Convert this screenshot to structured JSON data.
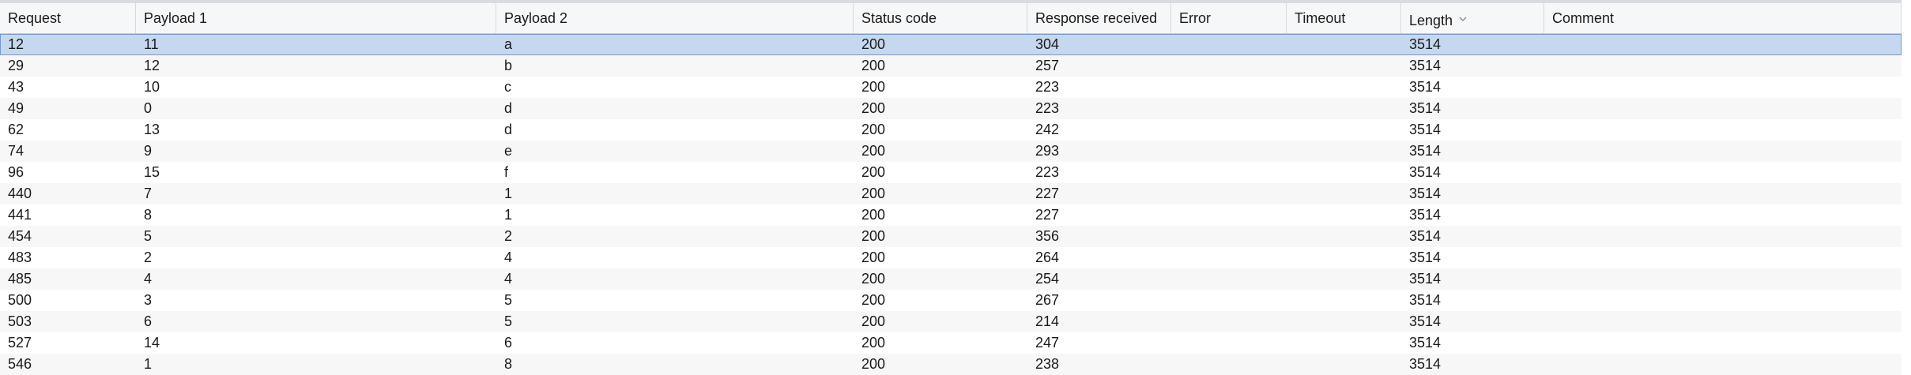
{
  "columns": [
    {
      "key": "request",
      "label": "Request"
    },
    {
      "key": "payload1",
      "label": "Payload 1"
    },
    {
      "key": "payload2",
      "label": "Payload 2"
    },
    {
      "key": "status",
      "label": "Status code"
    },
    {
      "key": "response",
      "label": "Response received"
    },
    {
      "key": "error",
      "label": "Error"
    },
    {
      "key": "timeout",
      "label": "Timeout"
    },
    {
      "key": "length",
      "label": "Length",
      "sorted": "descending"
    },
    {
      "key": "comment",
      "label": "Comment"
    }
  ],
  "selected_row": 0,
  "rows": [
    [
      "12",
      "11",
      "a",
      "200",
      "304",
      "",
      "",
      "3514",
      ""
    ],
    [
      "29",
      "12",
      "b",
      "200",
      "257",
      "",
      "",
      "3514",
      ""
    ],
    [
      "43",
      "10",
      "c",
      "200",
      "223",
      "",
      "",
      "3514",
      ""
    ],
    [
      "49",
      "0",
      "d",
      "200",
      "223",
      "",
      "",
      "3514",
      ""
    ],
    [
      "62",
      "13",
      "d",
      "200",
      "242",
      "",
      "",
      "3514",
      ""
    ],
    [
      "74",
      "9",
      "e",
      "200",
      "293",
      "",
      "",
      "3514",
      ""
    ],
    [
      "96",
      "15",
      "f",
      "200",
      "223",
      "",
      "",
      "3514",
      ""
    ],
    [
      "440",
      "7",
      "1",
      "200",
      "227",
      "",
      "",
      "3514",
      ""
    ],
    [
      "441",
      "8",
      "1",
      "200",
      "227",
      "",
      "",
      "3514",
      ""
    ],
    [
      "454",
      "5",
      "2",
      "200",
      "356",
      "",
      "",
      "3514",
      ""
    ],
    [
      "483",
      "2",
      "4",
      "200",
      "264",
      "",
      "",
      "3514",
      ""
    ],
    [
      "485",
      "4",
      "4",
      "200",
      "254",
      "",
      "",
      "3514",
      ""
    ],
    [
      "500",
      "3",
      "5",
      "200",
      "267",
      "",
      "",
      "3514",
      ""
    ],
    [
      "503",
      "6",
      "5",
      "200",
      "214",
      "",
      "",
      "3514",
      ""
    ],
    [
      "527",
      "14",
      "6",
      "200",
      "247",
      "",
      "",
      "3514",
      ""
    ],
    [
      "546",
      "1",
      "8",
      "200",
      "238",
      "",
      "",
      "3514",
      ""
    ]
  ],
  "colors": {
    "selected_bg": "#c6d8f0",
    "selected_border": "#6f9ad6",
    "header_bg": "#f6f7f9"
  }
}
